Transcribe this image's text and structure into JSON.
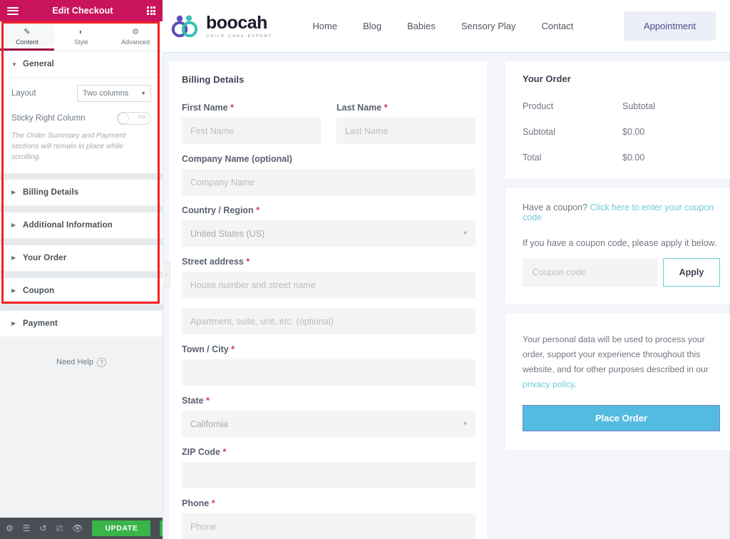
{
  "panel": {
    "header": {
      "title": "Edit Checkout",
      "menu_icon": "hamburger-icon",
      "grid_icon": "grid-icon"
    },
    "tabs": [
      {
        "label": "Content",
        "icon": "pencil-icon",
        "active": true
      },
      {
        "label": "Style",
        "icon": "contrast-icon",
        "active": false
      },
      {
        "label": "Advanced",
        "icon": "gear-icon",
        "active": false
      }
    ],
    "sections": [
      {
        "title": "General",
        "expanded": true
      },
      {
        "title": "Billing Details",
        "expanded": false
      },
      {
        "title": "Additional Information",
        "expanded": false
      },
      {
        "title": "Your Order",
        "expanded": false
      },
      {
        "title": "Coupon",
        "expanded": false
      },
      {
        "title": "Payment",
        "expanded": false
      }
    ],
    "general": {
      "layout_label": "Layout",
      "layout_value": "Two columns",
      "sticky_label": "Sticky Right Column",
      "sticky_value": "NO",
      "sticky_note": "The Order Summary and Payment sections will remain in place while scrolling."
    },
    "need_help": "Need Help",
    "footer": {
      "icons": [
        "gear-icon",
        "layers-icon",
        "history-icon",
        "responsive-icon",
        "eye-icon"
      ],
      "update_label": "UPDATE",
      "update_caret": "▲"
    },
    "collapse_arrow": "‹",
    "highlight_color": "#f32121",
    "header_color": "#c9135b"
  },
  "site": {
    "logo": {
      "word": "boocah",
      "tagline": "CHILD CARE EXPERT"
    },
    "nav": [
      {
        "label": "Home"
      },
      {
        "label": "Blog"
      },
      {
        "label": "Babies"
      },
      {
        "label": "Sensory Play"
      },
      {
        "label": "Contact"
      }
    ],
    "appointment_button": "Appointment"
  },
  "billing": {
    "title": "Billing Details",
    "fields": [
      {
        "label": "First Name",
        "required": true,
        "placeholder": "First Name",
        "value": "",
        "type": "text"
      },
      {
        "label": "Last Name",
        "required": true,
        "placeholder": "Last Name",
        "value": "",
        "type": "text"
      },
      {
        "label": "Company Name (optional)",
        "required": false,
        "placeholder": "Company Name",
        "value": "",
        "type": "text"
      },
      {
        "label": "Country / Region",
        "required": true,
        "placeholder": "",
        "value": "United States (US)",
        "type": "select"
      },
      {
        "label": "Street address",
        "required": true,
        "placeholder": "House number and street name",
        "value": "",
        "type": "text"
      },
      {
        "label": "",
        "required": false,
        "placeholder": "Apartment, suite, unit, etc. (optional)",
        "value": "",
        "type": "text"
      },
      {
        "label": "Town / City",
        "required": true,
        "placeholder": "",
        "value": "",
        "type": "text"
      },
      {
        "label": "State",
        "required": true,
        "placeholder": "",
        "value": "California",
        "type": "select"
      },
      {
        "label": "ZIP Code",
        "required": true,
        "placeholder": "",
        "value": "",
        "type": "text"
      },
      {
        "label": "Phone",
        "required": true,
        "placeholder": "Phone",
        "value": "",
        "type": "text"
      }
    ]
  },
  "order": {
    "title": "Your Order",
    "head_product": "Product",
    "head_subtotal": "Subtotal",
    "rows": [
      {
        "label": "Subtotal",
        "value": "$0.00"
      },
      {
        "label": "Total",
        "value": "$0.00"
      }
    ]
  },
  "coupon": {
    "prompt_text": "Have a coupon? ",
    "prompt_link": "Click here to enter your coupon code",
    "hint": "If you have a coupon code, please apply it below.",
    "placeholder": "Coupon code",
    "value": "",
    "apply_label": "Apply",
    "link_color": "#6fcbd6"
  },
  "payment": {
    "privacy_text_1": "Your personal data will be used to process your order, support your experience throughout this website, and for other purposes described in our ",
    "privacy_link": "privacy policy",
    "privacy_text_2": ".",
    "place_order_label": "Place Order",
    "button_color": "#54bbe0"
  }
}
